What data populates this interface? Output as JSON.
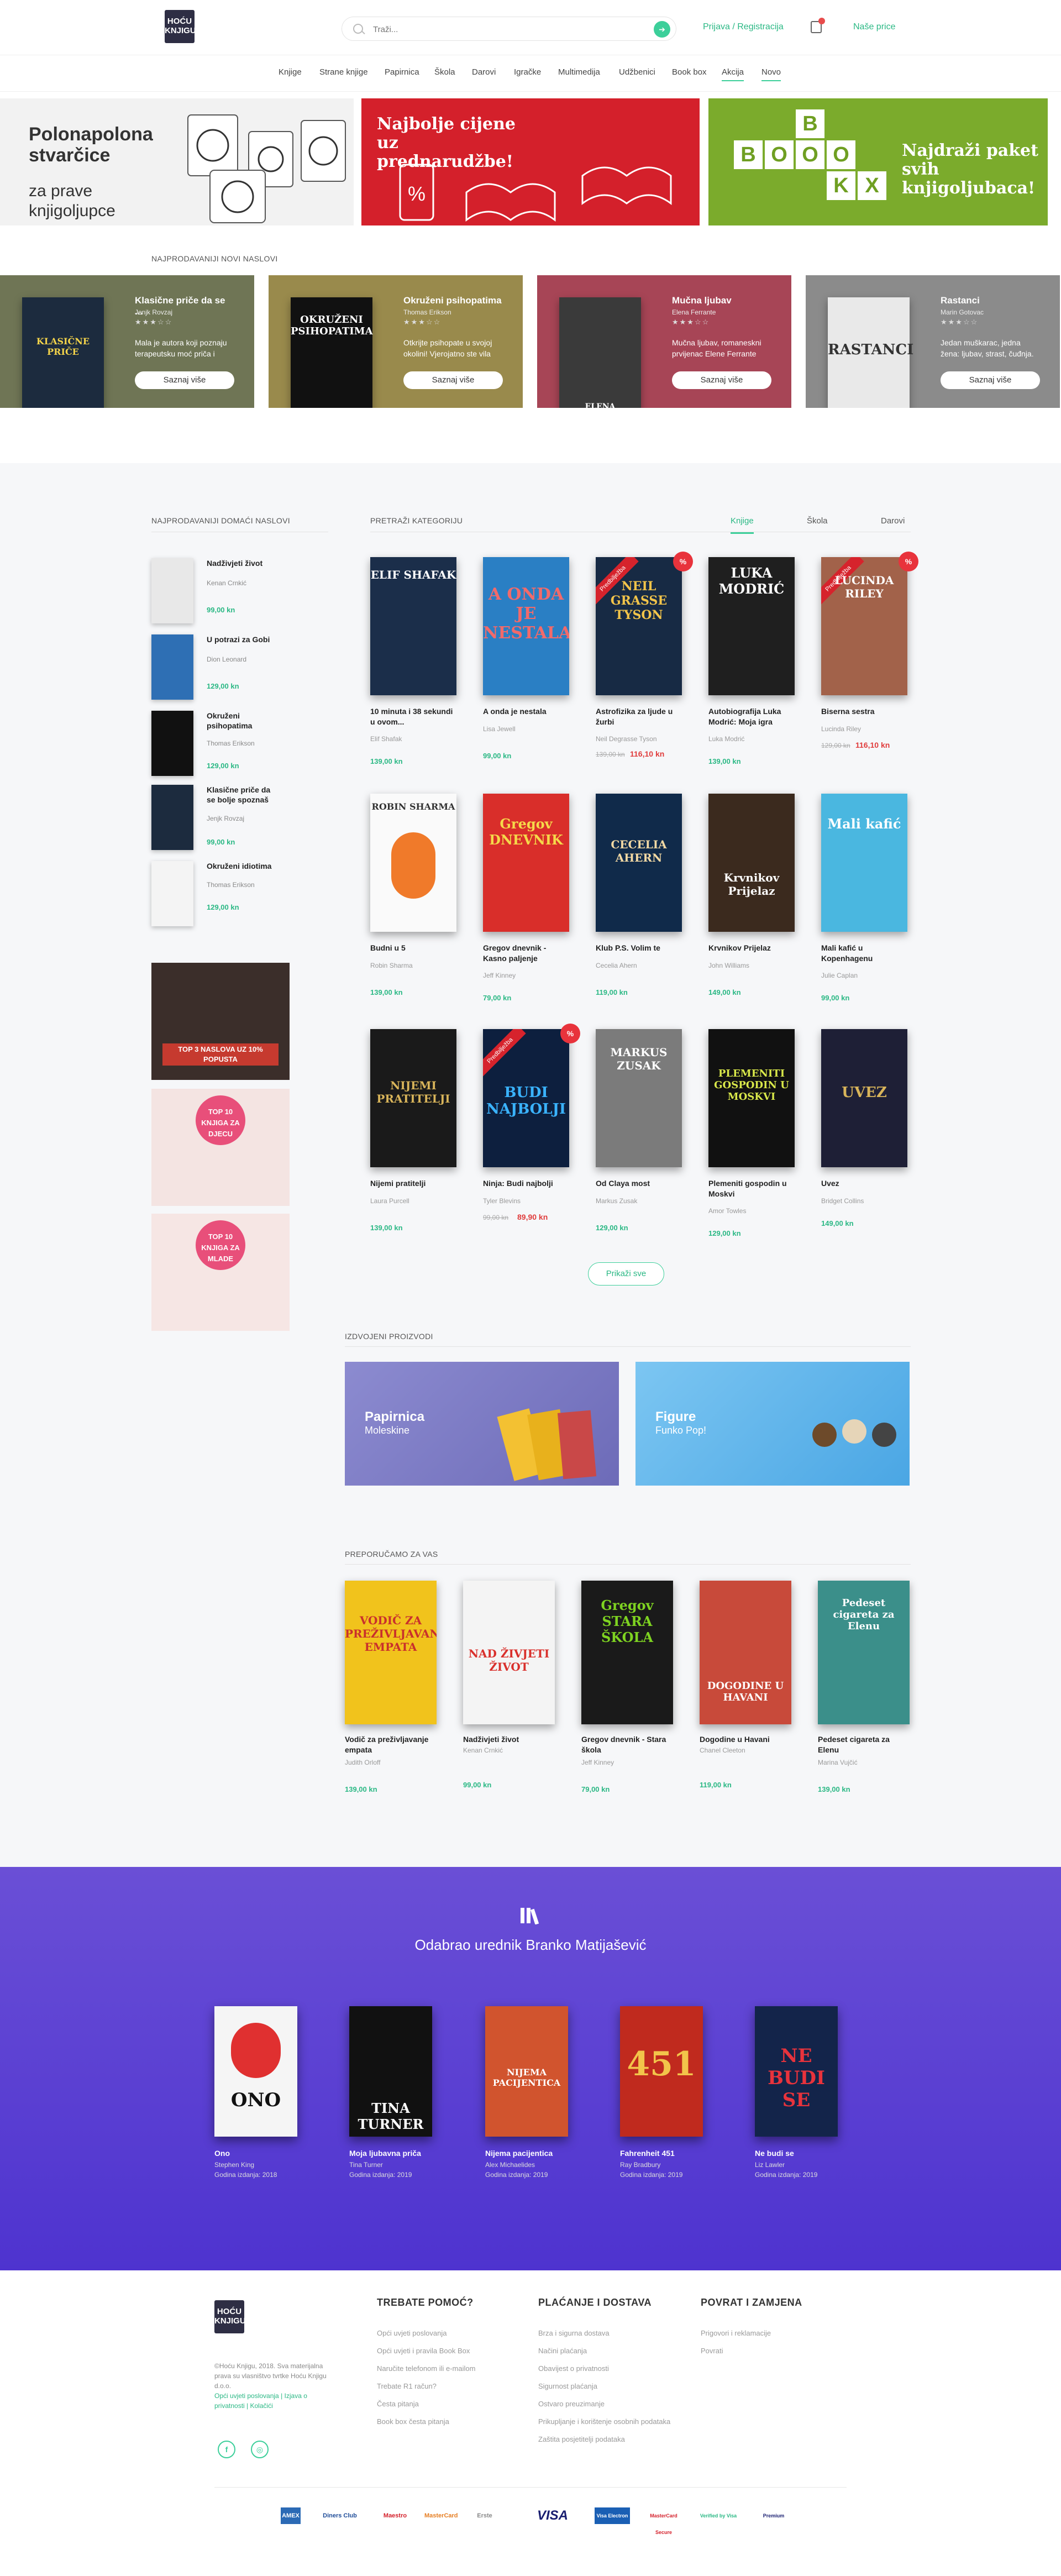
{
  "header": {
    "logo": "HOĆU KNJIGU",
    "search_placeholder": "Traži...",
    "login": "Prijava / Registracija",
    "our_prices": "Naše price"
  },
  "nav": [
    "Knjige",
    "Strane knjige",
    "Papirnica",
    "Škola",
    "Darovi",
    "Igračke",
    "Multimedija",
    "Udžbenici",
    "Book box",
    "Akcija",
    "Novo"
  ],
  "banners": {
    "b1_title": "Polonapolona stvarčice",
    "b1_sub": "za prave knjigoljupce",
    "b2_title": "Najbolje cijene uz prednarudžbe!",
    "b3_letters": [
      "B",
      "O",
      "O",
      "K",
      "B",
      "O",
      "X"
    ],
    "b3_title": "Najdraži paket svih knjigoljubaca!"
  },
  "featured_label": "NAJPRODAVANIJI NOVI NASLOVI",
  "featured": [
    {
      "title": "Klasične priče da se ...",
      "author": "Jenjk Rovzaj",
      "stars": "★★★☆☆",
      "desc": "Mala je autora koji poznaju terapeutsku moć priča i",
      "button": "Saznaj više",
      "bg": "#6f7555",
      "cover_bg": "#1c2b3e",
      "cover_text": "KLASIČNE PRIČE"
    },
    {
      "title": "Okruženi psihopatima",
      "author": "Thomas Erikson",
      "stars": "★★★☆☆",
      "desc": "Otkrijte psihopate u svojoj okolini! Vjerojatno ste vila",
      "button": "Saznaj više",
      "bg": "#998a4c",
      "cover_bg": "#111",
      "cover_text": "OKRUŽENI PSIHOPATIMA"
    },
    {
      "title": "Mučna ljubav",
      "author": "Elena Ferrante",
      "stars": "★★★☆☆",
      "desc": "Mučna ljubav, romaneskni prvijenac Elene Ferrante",
      "button": "Saznaj više",
      "bg": "#a74556",
      "cover_bg": "#3a3a3a",
      "cover_text": "ELENA FERRANTE"
    },
    {
      "title": "Rastanci",
      "author": "Marin Gotovac",
      "stars": "★★★☆☆",
      "desc": "Jedan muškarac, jedna žena: ljubav, strast, čuđnja.",
      "button": "Saznaj više",
      "bg": "#8b8b8b",
      "cover_bg": "#e9e9e9",
      "cover_text": "RASTANCI"
    }
  ],
  "sidebar_label": "NAJPRODAVANIJI DOMAĆI NASLOVI",
  "sidebar_items": [
    {
      "title": "Nadživjeti život",
      "author": "Kenan Crnkić",
      "price": "99,00 kn",
      "bg": "#e8e8e8"
    },
    {
      "title": "U potrazi za Gobi",
      "author": "Dion Leonard",
      "price": "129,00 kn",
      "bg": "#2e6fb4"
    },
    {
      "title": "Okruženi psihopatima",
      "author": "Thomas Erikson",
      "price": "129,00 kn",
      "bg": "#111"
    },
    {
      "title": "Klasične priče da se bolje spoznaš",
      "author": "Jenjk Rovzaj",
      "price": "99,00 kn",
      "bg": "#1c2b3e"
    },
    {
      "title": "Okruženi idiotima",
      "author": "Thomas Erikson",
      "price": "129,00 kn",
      "bg": "#f4f4f4"
    }
  ],
  "promos": [
    {
      "text": "TOP 3 NASLOVA UZ 10% POPUSTA",
      "bg": "#3b2e2a"
    },
    {
      "text": "TOP 10 KNJIGA ZA DJECU",
      "bg": "#f4e4e2"
    },
    {
      "text": "TOP 10 KNJIGA ZA MLADE",
      "bg": "#f6e6e4"
    }
  ],
  "categories": {
    "label": "PRETRAŽI KATEGORIJU",
    "tabs": [
      "Knjige",
      "Škola",
      "Darovi"
    ],
    "books": [
      {
        "title": "10 minuta i 38 sekundi u ovom...",
        "author": "Elif Shafak",
        "price": "139,00 kn",
        "bg": "#1b2e4a",
        "ct": "ELIF SHAFAK"
      },
      {
        "title": "A onda je nestala",
        "author": "Lisa Jewell",
        "price": "99,00 kn",
        "bg": "#2a7fc4",
        "ct": "A ONDA JE NESTALA"
      },
      {
        "title": "Astrofizika za ljude u žurbi",
        "author": "Neil Degrasse Tyson",
        "old": "139,00 kn",
        "price": "116,10 kn",
        "bg": "#172a44",
        "ct": "NEIL GRASSE TYSON",
        "sale": "%"
      },
      {
        "title": "Autobiografija Luka Modrić: Moja igra",
        "author": "Luka Modrić",
        "price": "139,00 kn",
        "bg": "#1f1f1f",
        "ct": "LUKA MODRIĆ"
      },
      {
        "title": "Biserna sestra",
        "author": "Lucinda Riley",
        "old": "129,00 kn",
        "price": "116,10 kn",
        "bg": "#a2624a",
        "ct": "LUCINDA RILEY",
        "sale": "%"
      },
      {
        "title": "Budni u 5",
        "author": "Robin Sharma",
        "price": "139,00 kn",
        "bg": "#fafafa",
        "ct": "ROBIN SHARMA"
      },
      {
        "title": "Gregov dnevnik - Kasno paljenje",
        "author": "Jeff Kinney",
        "price": "79,00 kn",
        "bg": "#d92e2a",
        "ct": "Gregov DNEVNIK"
      },
      {
        "title": "Klub P.S. Volim te",
        "author": "Cecelia Ahern",
        "price": "119,00 kn",
        "bg": "#102a4a",
        "ct": "CECELIA AHERN"
      },
      {
        "title": "Krvnikov Prijelaz",
        "author": "John Williams",
        "price": "149,00 kn",
        "bg": "#3b2a1e",
        "ct": "Krvnikov Prijelaz"
      },
      {
        "title": "Mali kafić u Kopenhagenu",
        "author": "Julie Caplan",
        "price": "99,00 kn",
        "bg": "#4ab7e0",
        "ct": "Mali kafić"
      },
      {
        "title": "Nijemi pratitelji",
        "author": "Laura Purcell",
        "price": "139,00 kn",
        "bg": "#1a1a1a",
        "ct": "NIJEMI PRATITELJI"
      },
      {
        "title": "Ninja: Budi najbolji",
        "author": "Tyler Blevins",
        "old": "99,00 kn",
        "price": "89,90 kn",
        "bg": "#0d1f3e",
        "ct": "BUDI NAJBOLJI",
        "sale": "%"
      },
      {
        "title": "Od Claya most",
        "author": "Markus Zusak",
        "price": "129,00 kn",
        "bg": "#7b7b7b",
        "ct": "MARKUS ZUSAK"
      },
      {
        "title": "Plemeniti gospodin u Moskvi",
        "author": "Amor Towles",
        "price": "129,00 kn",
        "bg": "#111",
        "ct": "PLEMENITI GOSPODIN U MOSKVI"
      },
      {
        "title": "Uvez",
        "author": "Bridget Collins",
        "price": "149,00 kn",
        "bg": "#1e1f36",
        "ct": "UVEZ"
      }
    ],
    "more": "Prikaži sve"
  },
  "highlighted": {
    "label": "IZDVOJENI PROIZVODI",
    "items": [
      {
        "title": "Papirnica",
        "sub": "Moleskine",
        "bg": "#7b79c0"
      },
      {
        "title": "Figure",
        "sub": "Funko Pop!",
        "bg": "#5ab2e8"
      }
    ]
  },
  "recommended": {
    "label": "PREPORUČAMO ZA VAS",
    "books": [
      {
        "title": "Vodič za preživljavanje empata",
        "author": "Judith Orloff",
        "price": "139,00 kn",
        "bg": "#f1c31c",
        "ct": "VODIČ ZA PREŽIVLJAVANJE EMPATA"
      },
      {
        "title": "Nadživjeti život",
        "author": "Kenan Crnkić",
        "price": "99,00 kn",
        "bg": "#f4f4f4",
        "ct": "NAD ŽIVJETI ŽIVOT"
      },
      {
        "title": "Gregov dnevnik - Stara škola",
        "author": "Jeff Kinney",
        "price": "79,00 kn",
        "bg": "#1a1a1a",
        "ct": "Gregov STARA ŠKOLA"
      },
      {
        "title": "Dogodine u Havani",
        "author": "Chanel Cleeton",
        "price": "119,00 kn",
        "bg": "#c84a3a",
        "ct": "DOGODINE U HAVANI"
      },
      {
        "title": "Pedeset cigareta za Elenu",
        "author": "Marina Vujčić",
        "price": "139,00 kn",
        "bg": "#3b8f8a",
        "ct": "Pedeset cigareta za Elenu"
      }
    ]
  },
  "editor": {
    "title": "Odabrao urednik Branko Matijašević",
    "books": [
      {
        "title": "Ono",
        "author": "Stephen King",
        "year": "Godina izdanja: 2018",
        "bg": "#f5f5f5",
        "ct": "ONO"
      },
      {
        "title": "Moja ljubavna priča",
        "author": "Tina Turner",
        "year": "Godina izdanja: 2019",
        "bg": "#111",
        "ct": "TINA TURNER"
      },
      {
        "title": "Nijema pacijentica",
        "author": "Alex Michaelides",
        "year": "Godina izdanja: 2019",
        "bg": "#d1542e",
        "ct": "NIJEMA PACIJENTICA"
      },
      {
        "title": "Fahrenheit 451",
        "author": "Ray Bradbury",
        "year": "Godina izdanja: 2019",
        "bg": "#c02a1e",
        "ct": "451"
      },
      {
        "title": "Ne budi se",
        "author": "Liz Lawler",
        "year": "Godina izdanja: 2019",
        "bg": "#13244a",
        "ct": "NE BUDI SE"
      }
    ]
  },
  "footer": {
    "about": "©Hoću Knjigu, 2018. Sva materijalna prava su vlasništvo tvrtke Hoću Knjigu d.o.o.",
    "links": "Opći uvjeti poslovanja | Izjava o privatnosti | Kolačići",
    "col1": {
      "title": "TREBATE POMOĆ?",
      "items": [
        "Opći uvjeti poslovanja",
        "Opći uvjeti i pravila Book Box",
        "Naručite telefonom ili e-mailom",
        "Trebate R1 račun?",
        "Česta pitanja",
        "Book box česta pitanja"
      ]
    },
    "col2": {
      "title": "PLAĆANJE I DOSTAVA",
      "items": [
        "Brza i sigurna dostava",
        "Načini plaćanja",
        "Obavijest o privatnosti",
        "Sigurnost plaćanja",
        "Ostvaro preuzimanje",
        "Prikupljanje i korištenje osobnih podataka",
        "Zaštita posjetitelji podataka"
      ]
    },
    "col3": {
      "title": "POVRAT I ZAMJENA",
      "items": [
        "Prigovori i reklamacije",
        "Povrati"
      ]
    },
    "payments": [
      "AMEX",
      "Diners Club",
      "Maestro",
      "MasterCard",
      "Erste",
      "VISA",
      "Visa Electron",
      "MasterCard Secure",
      "Verified by Visa",
      "Premium"
    ]
  }
}
